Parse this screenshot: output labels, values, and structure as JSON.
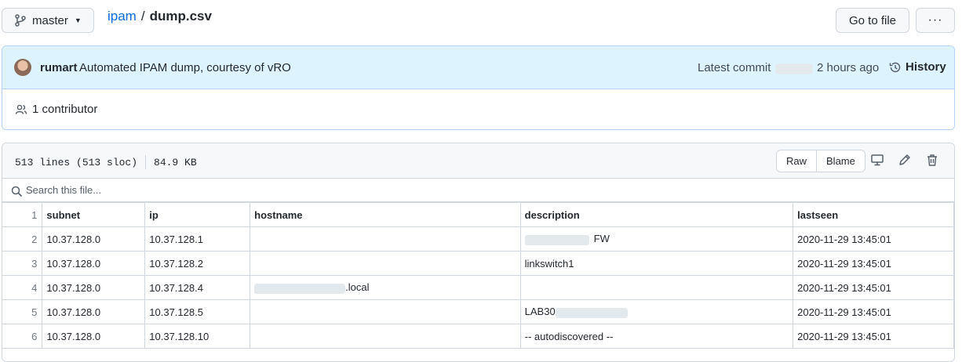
{
  "top": {
    "branch": "master",
    "repo": "ipam",
    "separator": "/",
    "file": "dump.csv",
    "goto_label": "Go to file",
    "more_label": "···"
  },
  "commit": {
    "author": "rumart",
    "message": "Automated IPAM dump, courtesy of vRO",
    "latest_label": "Latest commit",
    "time_ago": "2 hours ago",
    "history_label": "History",
    "contributors": "1 contributor"
  },
  "file": {
    "lines": "513 lines (513 sloc)",
    "size": "84.9 KB",
    "raw_label": "Raw",
    "blame_label": "Blame",
    "search_placeholder": "Search this file..."
  },
  "table": {
    "headers": [
      "subnet",
      "ip",
      "hostname",
      "description",
      "lastseen"
    ],
    "header_line": "1",
    "rows": [
      {
        "line": "2",
        "subnet": "10.37.128.0",
        "ip": "10.37.128.1",
        "hostname": "",
        "description": "FW",
        "lastseen": "2020-11-29 13:45:01"
      },
      {
        "line": "3",
        "subnet": "10.37.128.0",
        "ip": "10.37.128.2",
        "hostname": "",
        "description": "linkswitch1",
        "lastseen": "2020-11-29 13:45:01"
      },
      {
        "line": "4",
        "subnet": "10.37.128.0",
        "ip": "10.37.128.4",
        "hostname": ".local",
        "description": "",
        "lastseen": "2020-11-29 13:45:01"
      },
      {
        "line": "5",
        "subnet": "10.37.128.0",
        "ip": "10.37.128.5",
        "hostname": "",
        "description": "LAB30",
        "lastseen": "2020-11-29 13:45:01"
      },
      {
        "line": "6",
        "subnet": "10.37.128.0",
        "ip": "10.37.128.10",
        "hostname": "",
        "description": "-- autodiscovered --",
        "lastseen": "2020-11-29 13:45:01"
      }
    ]
  },
  "colors": {
    "link": "#0969da",
    "commit_bg": "#ddf4ff",
    "border": "#d0d7de"
  }
}
